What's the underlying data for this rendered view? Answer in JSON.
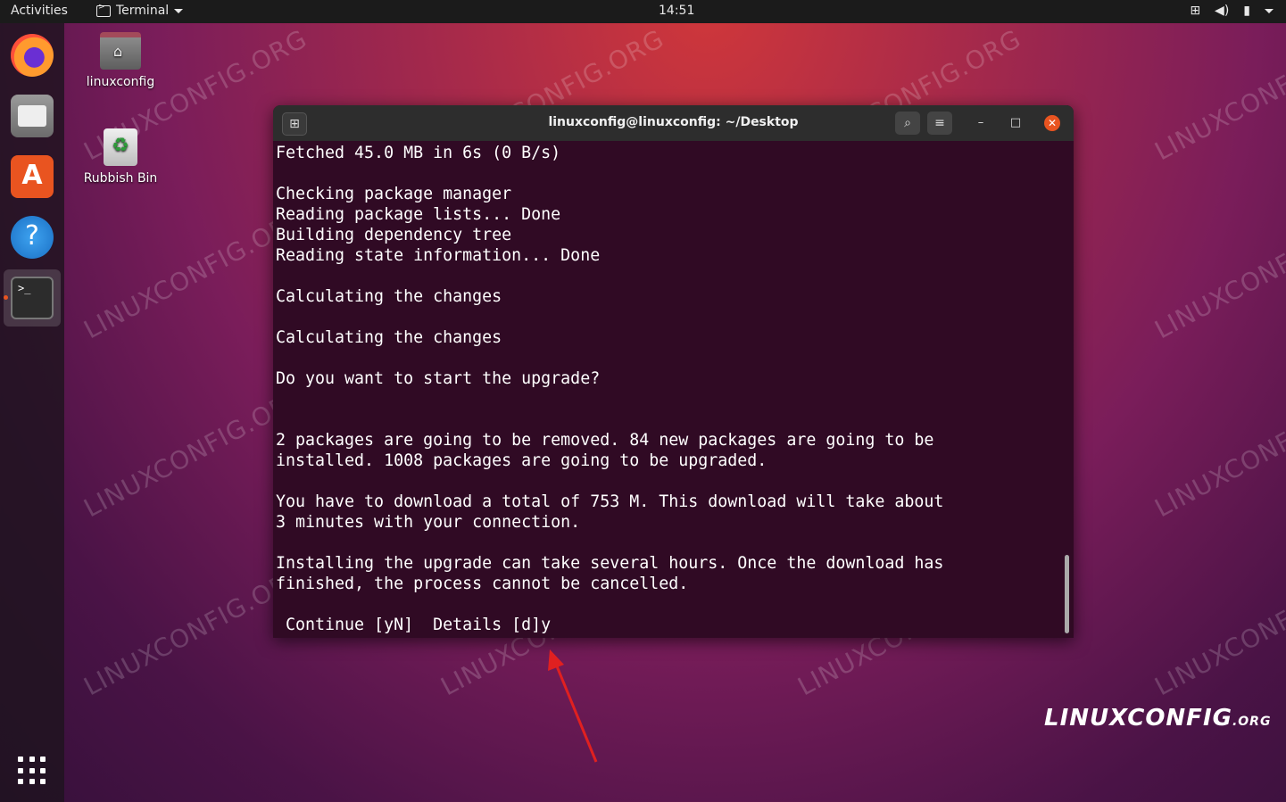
{
  "topbar": {
    "activities": "Activities",
    "app_name": "Terminal",
    "clock": "14:51"
  },
  "desktop": {
    "folder_label": "linuxconfig",
    "bin_label": "Rubbish Bin"
  },
  "watermark": "LINUXCONFIG.ORG",
  "terminal": {
    "title": "linuxconfig@linuxconfig: ~/Desktop",
    "lines": [
      "Fetched 45.0 MB in 6s (0 B/s)",
      "",
      "Checking package manager",
      "Reading package lists... Done",
      "Building dependency tree",
      "Reading state information... Done",
      "",
      "Calculating the changes",
      "",
      "Calculating the changes",
      "",
      "Do you want to start the upgrade?",
      "",
      "",
      "2 packages are going to be removed. 84 new packages are going to be",
      "installed. 1008 packages are going to be upgraded.",
      "",
      "You have to download a total of 753 M. This download will take about",
      "3 minutes with your connection.",
      "",
      "Installing the upgrade can take several hours. Once the download has",
      "finished, the process cannot be cancelled.",
      "",
      " Continue [yN]  Details [d]y"
    ]
  },
  "logo": {
    "linux": "LINUX",
    "config": "CONFIG",
    "org": ".ORG"
  }
}
